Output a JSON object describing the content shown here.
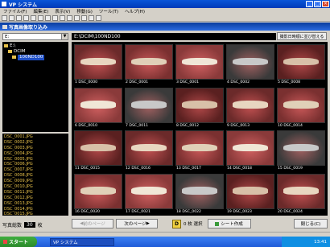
{
  "window": {
    "title": "VP システム"
  },
  "menu": [
    "ファイル(F)",
    "編集(E)",
    "表示(V)",
    "移動(G)",
    "ツール(T)",
    "ヘルプ(H)"
  ],
  "subwindow": {
    "title": "写真画像取り込み"
  },
  "drive": {
    "value": "E:"
  },
  "tree": [
    {
      "label": "E:\\",
      "selected": false
    },
    {
      "label": "DCIM",
      "selected": false
    },
    {
      "label": "100ND100",
      "selected": true
    }
  ],
  "files": [
    "DSC_0001.JPG",
    "DSC_0002.JPG",
    "DSC_0003.JPG",
    "DSC_0004.JPG",
    "DSC_0005.JPG",
    "DSC_0006.JPG",
    "DSC_0007.JPG",
    "DSC_0008.JPG",
    "DSC_0009.JPG",
    "DSC_0010.JPG",
    "DSC_0011.JPG",
    "DSC_0012.JPG",
    "DSC_0013.JPG",
    "DSC_0014.JPG",
    "DSC_0015.JPG"
  ],
  "count": {
    "label": "写真総数",
    "value": "30",
    "unit": "枚"
  },
  "path": {
    "value": "E:\\DCIM\\100ND100"
  },
  "sort_button": "撮影日時順に並び替える",
  "thumbnails": [
    {
      "n": "1",
      "file": "DSC_0000"
    },
    {
      "n": "2",
      "file": "DSC_0001"
    },
    {
      "n": "3",
      "file": "DSC_0001"
    },
    {
      "n": "4",
      "file": "DSC_0002"
    },
    {
      "n": "5",
      "file": "DSC_0008"
    },
    {
      "n": "6",
      "file": "DSC_0010"
    },
    {
      "n": "7",
      "file": "DSC_0011"
    },
    {
      "n": "8",
      "file": "DSC_0012"
    },
    {
      "n": "9",
      "file": "DSC_0013"
    },
    {
      "n": "10",
      "file": "DSC_0014"
    },
    {
      "n": "11",
      "file": "DSC_0015"
    },
    {
      "n": "12",
      "file": "DSC_0016"
    },
    {
      "n": "13",
      "file": "DSC_0017"
    },
    {
      "n": "14",
      "file": "DSC_0018"
    },
    {
      "n": "15",
      "file": "DSC_0019"
    },
    {
      "n": "16",
      "file": "DSC_0020"
    },
    {
      "n": "17",
      "file": "DSC_0021"
    },
    {
      "n": "18",
      "file": "DSC_0022"
    },
    {
      "n": "19",
      "file": "DSC_0023"
    },
    {
      "n": "20",
      "file": "DSC_0024"
    }
  ],
  "bottom": {
    "prev_page": "前のページ",
    "next_page": "次のページ",
    "selected_badge": "D",
    "selected_count": "0",
    "selected_label": "枚 選択",
    "create_sheet": "シート作成",
    "close": "閉じる(C)"
  },
  "taskbar": {
    "start": "スタート",
    "task": "VP システム",
    "time": "13:41"
  },
  "colors": {
    "title_blue": "#0a55d8",
    "grid_bg": "#000000",
    "badge_yellow": "#f0d040"
  }
}
